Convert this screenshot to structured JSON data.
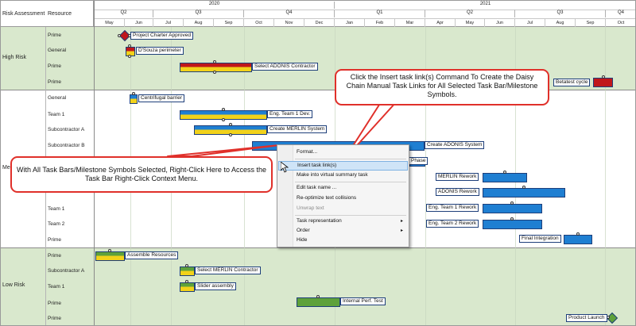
{
  "header": {
    "col_risk": "Risk Assessment",
    "col_resource": "Resource",
    "years": [
      "2020",
      "2021"
    ],
    "quarters": [
      "Q2",
      "Q3",
      "Q4",
      "Q1",
      "Q2",
      "Q3",
      "Q4"
    ],
    "months": [
      "May",
      "Jun",
      "Jul",
      "Aug",
      "Sep",
      "Oct",
      "Nov",
      "Dec",
      "Jan",
      "Feb",
      "Mar",
      "Apr",
      "May",
      "Jun",
      "Jul",
      "Aug",
      "Sep",
      "Oct"
    ]
  },
  "groups": {
    "high": "High Risk",
    "medium": "Med",
    "low": "Low Risk"
  },
  "resources": {
    "r1": "Prime",
    "r2": "General",
    "r3": "Prime",
    "r4": "Prime",
    "r5": "General",
    "r6": "Team 1",
    "r7": "Subcontractor A",
    "r8": "Subcontractor B",
    "r9": "Team 1",
    "r10": "Team 2",
    "r11": "Prime",
    "r12": "Prime",
    "r13": "Subcontractor A",
    "r14": "Team 1",
    "r15": "Prime",
    "r16": "Prime"
  },
  "tasks": {
    "project_charter": "Project Charter Approved",
    "dsouza": "D'Souza perimeter",
    "select_adonis": "Select ADONIS Contractor",
    "betatest": "Betatest cycle",
    "centrifugal": "Centrifugal barrier",
    "eng_team1_dev": "Eng. Team 1 Dev.",
    "create_merlin": "Create MERLIN System",
    "create_adonis": "Create ADONIS System",
    "phase": "Phase",
    "merlin_rework": "MERLIN Rework",
    "adonis_rework": "ADONIS Rework",
    "eng_team1_rework": "Eng. Team 1 Rework",
    "eng_team2_rework": "Eng. Team 2 Rework",
    "final_integration": "Final Integration",
    "assemble_resources": "Assemble Resources",
    "select_merlin": "Select MERLIN Contractor",
    "slider": "Slider assembly",
    "internal_perf": "Internal Perf. Test",
    "product_launch": "Product Launch"
  },
  "context_menu": {
    "format": "Format...",
    "insert_links": "Insert task link(s)",
    "virtual_summary": "Make into virtual summary task",
    "edit_name": "Edit task name ...",
    "reoptimize": "Re-optimize text collisions",
    "unwrap": "Unwrap text",
    "representation": "Task representation",
    "order": "Order",
    "hide": "Hide",
    "submenu_arrow": "▸"
  },
  "callouts": {
    "top": "Click the Insert task link(s) Command To Create the Daisy Chain Manual Task Links for All Selected Task Bar/Milestone Symbols.",
    "left": "With All Task Bars/Milestone Symbols Selected, Right-Click Here to Access the Task Bar Right-Click Context Menu."
  },
  "colors": {
    "band_green": "#d9e8cd",
    "bar_blue": "#1f7fd2",
    "bar_red": "#c0171b",
    "bar_green": "#5ea13a",
    "bar_yellow": "#f2d21a",
    "callout_border": "#e0302a",
    "menu_highlight": "#cfe4f7"
  },
  "icons": {
    "cursor": "mouse-pointer-icon",
    "milestone": "diamond-milestone-icon"
  }
}
